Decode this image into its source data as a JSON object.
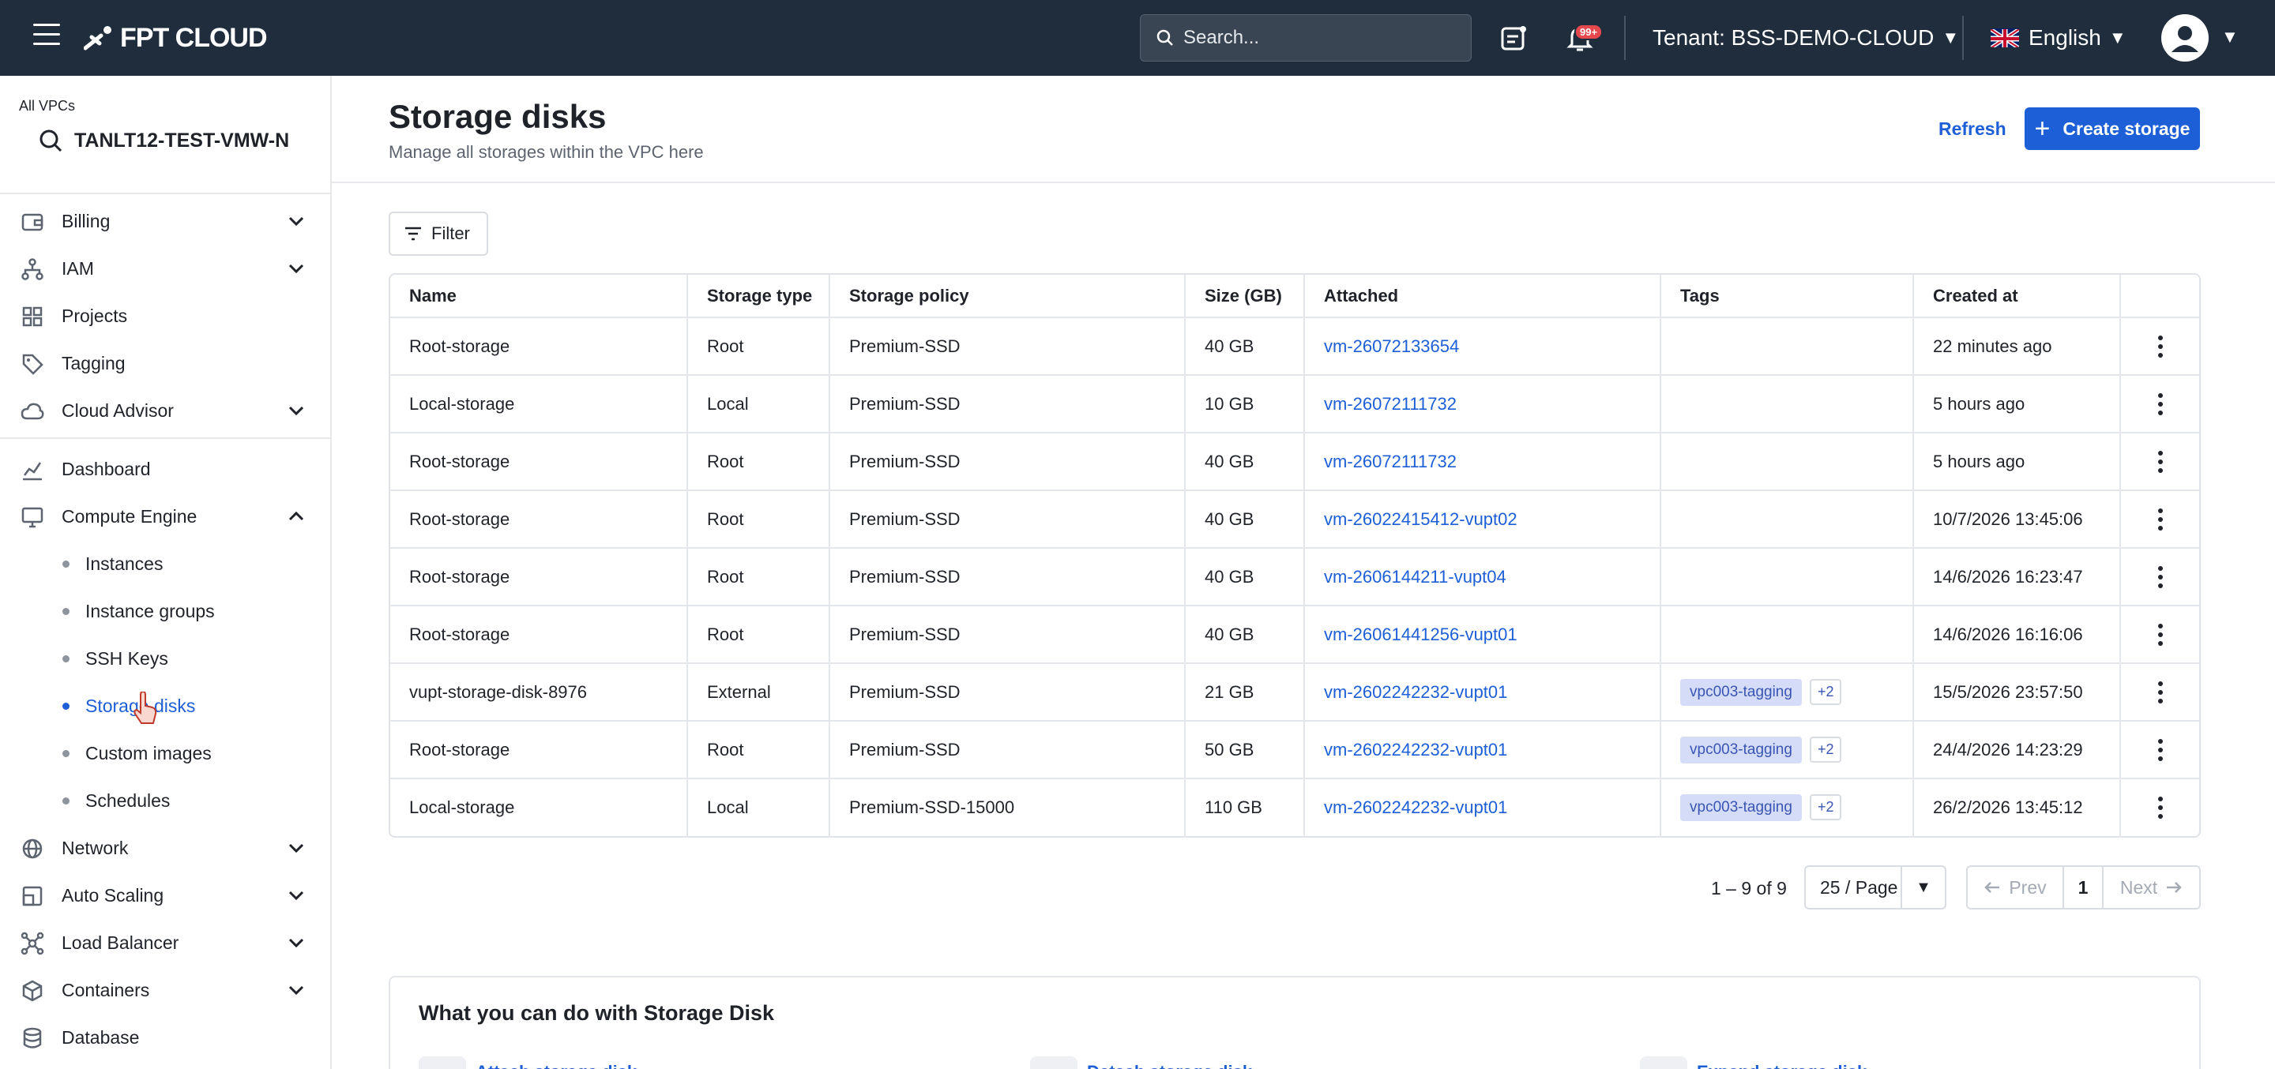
{
  "topbar": {
    "logo": "FPT CLOUD",
    "search_placeholder": "Search...",
    "notifications_badge": "99+",
    "tenant_label": "Tenant:",
    "tenant_value": "BSS-DEMO-CLOUD",
    "language": "English"
  },
  "sidebar": {
    "vpc_label": "All VPCs",
    "vpc_value": "TANLT12-TEST-VMW-N",
    "items": [
      {
        "label": "Billing",
        "icon": "wallet-icon"
      },
      {
        "label": "IAM",
        "icon": "hierarchy-icon"
      },
      {
        "label": "Projects",
        "icon": "grid-icon"
      },
      {
        "label": "Tagging",
        "icon": "tag-icon"
      },
      {
        "label": "Cloud Advisor",
        "icon": "cloud-icon"
      },
      {
        "label": "Dashboard",
        "icon": "chart-icon"
      },
      {
        "label": "Compute Engine",
        "icon": "monitor-icon"
      },
      {
        "label": "Network",
        "icon": "globe-icon"
      },
      {
        "label": "Auto Scaling",
        "icon": "scaling-icon"
      },
      {
        "label": "Load Balancer",
        "icon": "nodes-icon"
      },
      {
        "label": "Containers",
        "icon": "cube-icon"
      },
      {
        "label": "Database",
        "icon": "database-icon"
      }
    ],
    "compute_sub": [
      {
        "label": "Instances"
      },
      {
        "label": "Instance groups"
      },
      {
        "label": "SSH Keys"
      },
      {
        "label": "Storage disks"
      },
      {
        "label": "Custom images"
      },
      {
        "label": "Schedules"
      }
    ]
  },
  "main": {
    "title": "Storage disks",
    "subtitle": "Manage all storages within the VPC here",
    "refresh_label": "Refresh",
    "create_label": "Create storage",
    "filter_label": "Filter"
  },
  "table": {
    "columns": [
      "Name",
      "Storage type",
      "Storage policy",
      "Size (GB)",
      "Attached",
      "Tags",
      "Created at"
    ],
    "rows": [
      {
        "name": "Root-storage",
        "type": "Root",
        "policy": "Premium-SSD",
        "size": "40 GB",
        "attached": "vm-26072133654",
        "tag": "",
        "tag_more": "",
        "created": "22 minutes ago"
      },
      {
        "name": "Local-storage",
        "type": "Local",
        "policy": "Premium-SSD",
        "size": "10 GB",
        "attached": "vm-26072111732",
        "tag": "",
        "tag_more": "",
        "created": "5 hours ago"
      },
      {
        "name": "Root-storage",
        "type": "Root",
        "policy": "Premium-SSD",
        "size": "40 GB",
        "attached": "vm-26072111732",
        "tag": "",
        "tag_more": "",
        "created": "5 hours ago"
      },
      {
        "name": "Root-storage",
        "type": "Root",
        "policy": "Premium-SSD",
        "size": "40 GB",
        "attached": "vm-26022415412-vupt02",
        "tag": "",
        "tag_more": "",
        "created": "10/7/2026 13:45:06"
      },
      {
        "name": "Root-storage",
        "type": "Root",
        "policy": "Premium-SSD",
        "size": "40 GB",
        "attached": "vm-2606144211-vupt04",
        "tag": "",
        "tag_more": "",
        "created": "14/6/2026 16:23:47"
      },
      {
        "name": "Root-storage",
        "type": "Root",
        "policy": "Premium-SSD",
        "size": "40 GB",
        "attached": "vm-26061441256-vupt01",
        "tag": "",
        "tag_more": "",
        "created": "14/6/2026 16:16:06"
      },
      {
        "name": "vupt-storage-disk-8976",
        "type": "External",
        "policy": "Premium-SSD",
        "size": "21 GB",
        "attached": "vm-2602242232-vupt01",
        "tag": "vpc003-tagging",
        "tag_more": "+2",
        "created": "15/5/2026 23:57:50"
      },
      {
        "name": "Root-storage",
        "type": "Root",
        "policy": "Premium-SSD",
        "size": "50 GB",
        "attached": "vm-2602242232-vupt01",
        "tag": "vpc003-tagging",
        "tag_more": "+2",
        "created": "24/4/2026 14:23:29"
      },
      {
        "name": "Local-storage",
        "type": "Local",
        "policy": "Premium-SSD-15000",
        "size": "110 GB",
        "attached": "vm-2602242232-vupt01",
        "tag": "vpc003-tagging",
        "tag_more": "+2",
        "created": "26/2/2026 13:45:12"
      }
    ]
  },
  "pagination": {
    "range": "1 – 9 of 9",
    "page_size": "25 / Page",
    "prev": "Prev",
    "current": "1",
    "next": "Next"
  },
  "info_card": {
    "title": "What you can do with Storage Disk",
    "links": [
      "Attach storage disk",
      "Detach storage disk",
      "Expand storage disk"
    ]
  },
  "colors": {
    "topbar_bg": "#1f2d3d",
    "accent": "#1d5fd6",
    "tag_bg": "#d4dcf7"
  }
}
